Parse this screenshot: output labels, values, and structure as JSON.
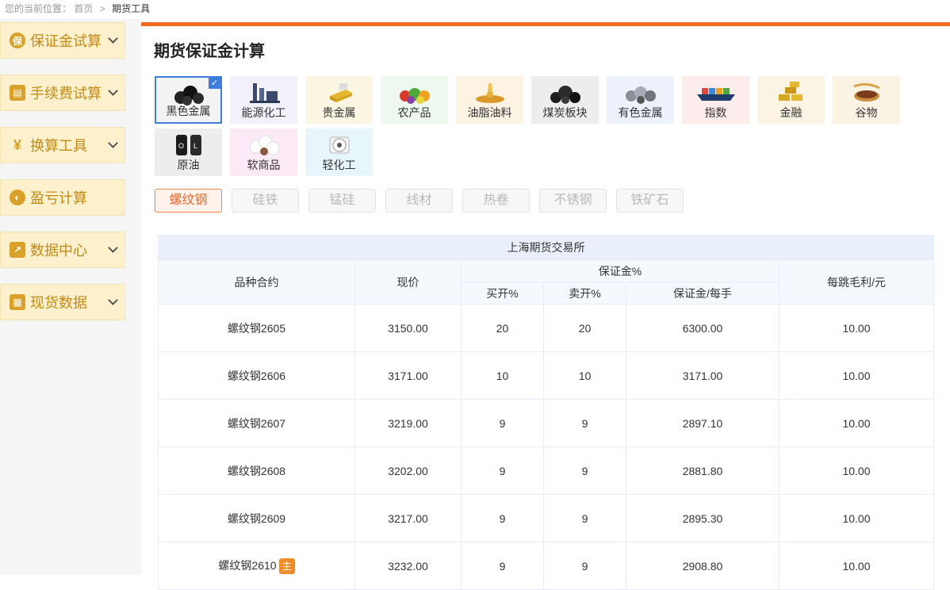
{
  "breadcrumb": {
    "prefix": "您的当前位置：",
    "home": "首页",
    "sep": ">",
    "current": "期货工具"
  },
  "sidebar": {
    "items": [
      {
        "label": "保证金试算",
        "icon": "保",
        "has_chevron": true
      },
      {
        "label": "手续费试算",
        "icon": "▤",
        "has_chevron": true
      },
      {
        "label": "换算工具",
        "icon": "¥",
        "has_chevron": true
      },
      {
        "label": "盈亏计算",
        "icon": "◐",
        "has_chevron": false
      },
      {
        "label": "数据中心",
        "icon": "↗",
        "has_chevron": true
      },
      {
        "label": "现货数据",
        "icon": "▦",
        "has_chevron": true
      }
    ]
  },
  "page": {
    "title": "期货保证金计算"
  },
  "categories": [
    {
      "label": "黑色金属",
      "icon": "black-metal-ore-icon",
      "bg": "#f3f3f3",
      "selected": true
    },
    {
      "label": "能源化工",
      "icon": "energy-chemical-icon",
      "bg": "#f1f0fb",
      "selected": false
    },
    {
      "label": "贵金属",
      "icon": "gold-bar-icon",
      "bg": "#faf6e1",
      "selected": false
    },
    {
      "label": "农产品",
      "icon": "vegetables-icon",
      "bg": "#eef8ee",
      "selected": false
    },
    {
      "label": "油脂油料",
      "icon": "oil-seeds-icon",
      "bg": "#fdf3e3",
      "selected": false
    },
    {
      "label": "煤炭板块",
      "icon": "coal-icon",
      "bg": "#ededed",
      "selected": false
    },
    {
      "label": "有色金属",
      "icon": "nonferrous-metal-icon",
      "bg": "#edf1fb",
      "selected": false
    },
    {
      "label": "指数",
      "icon": "cargo-ship-icon",
      "bg": "#fdecec",
      "selected": false
    },
    {
      "label": "金融",
      "icon": "gold-stack-icon",
      "bg": "#fbf3e3",
      "selected": false
    },
    {
      "label": "谷物",
      "icon": "grain-bowl-icon",
      "bg": "#faf3e3",
      "selected": false
    },
    {
      "label": "原油",
      "icon": "oil-barrel-icon",
      "bg": "#ededed",
      "selected": false
    },
    {
      "label": "软商品",
      "icon": "cotton-icon",
      "bg": "#fbe9f6",
      "selected": false
    },
    {
      "label": "轻化工",
      "icon": "paper-roll-icon",
      "bg": "#e7f6fb",
      "selected": false
    }
  ],
  "sub_tabs": [
    {
      "label": "螺纹钢",
      "active": true
    },
    {
      "label": "硅铁",
      "active": false
    },
    {
      "label": "锰硅",
      "active": false
    },
    {
      "label": "线材",
      "active": false
    },
    {
      "label": "热卷",
      "active": false
    },
    {
      "label": "不锈钢",
      "active": false
    },
    {
      "label": "铁矿石",
      "active": false
    }
  ],
  "table": {
    "exchange": "上海期货交易所",
    "headers": {
      "contract": "品种合约",
      "price": "现价",
      "margin_group": "保证金%",
      "buy": "买开%",
      "sell": "卖开%",
      "per_lot": "保证金/每手",
      "tick_profit": "每跳毛利/元"
    },
    "rows": [
      {
        "contract": "螺纹钢2605",
        "price": "3150.00",
        "buy": "20",
        "sell": "20",
        "per_lot": "6300.00",
        "tick": "10.00",
        "badge": ""
      },
      {
        "contract": "螺纹钢2606",
        "price": "3171.00",
        "buy": "10",
        "sell": "10",
        "per_lot": "3171.00",
        "tick": "10.00",
        "badge": ""
      },
      {
        "contract": "螺纹钢2607",
        "price": "3219.00",
        "buy": "9",
        "sell": "9",
        "per_lot": "2897.10",
        "tick": "10.00",
        "badge": ""
      },
      {
        "contract": "螺纹钢2608",
        "price": "3202.00",
        "buy": "9",
        "sell": "9",
        "per_lot": "2881.80",
        "tick": "10.00",
        "badge": ""
      },
      {
        "contract": "螺纹钢2609",
        "price": "3217.00",
        "buy": "9",
        "sell": "9",
        "per_lot": "2895.30",
        "tick": "10.00",
        "badge": ""
      },
      {
        "contract": "螺纹钢2610",
        "price": "3232.00",
        "buy": "9",
        "sell": "9",
        "per_lot": "2908.80",
        "tick": "10.00",
        "badge": "主"
      }
    ]
  }
}
